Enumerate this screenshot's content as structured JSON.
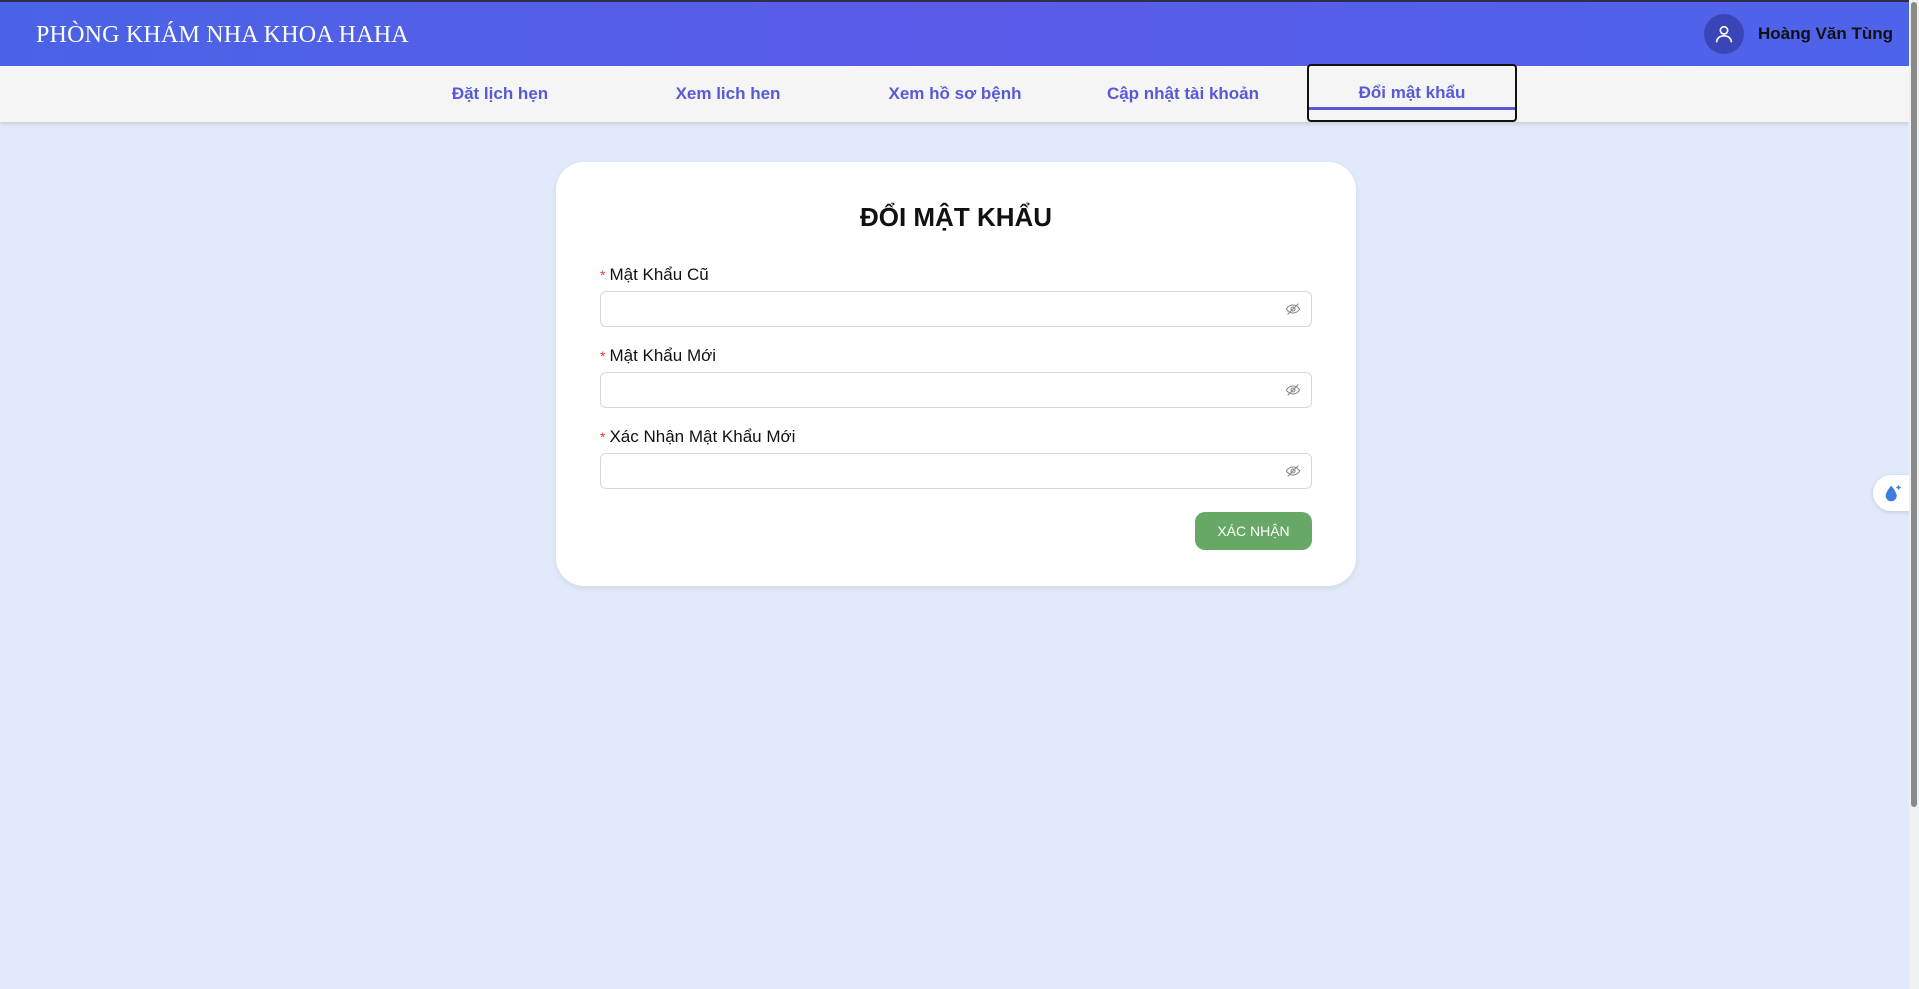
{
  "header": {
    "brand": "PHÒNG KHÁM NHA KHOA HAHA",
    "user_name": "Hoàng Văn Tùng"
  },
  "nav": {
    "items": [
      {
        "label": "Đặt lịch hẹn"
      },
      {
        "label": "Xem lich hen"
      },
      {
        "label": "Xem hồ sơ bệnh"
      },
      {
        "label": "Cập nhật tài khoản"
      },
      {
        "label": "Đổi mật khẩu",
        "active": true
      }
    ]
  },
  "form": {
    "title": "ĐỔI MẬT KHẨU",
    "fields": [
      {
        "label": "Mật Khẩu Cũ",
        "required": true,
        "value": ""
      },
      {
        "label": "Mật Khẩu Mới",
        "required": true,
        "value": ""
      },
      {
        "label": "Xác Nhận Mật Khẩu Mới",
        "required": true,
        "value": ""
      }
    ],
    "required_mark": "*",
    "submit_label": "XÁC NHẬN"
  },
  "colors": {
    "accent": "#5759d6",
    "submit": "#67a867",
    "background": "#e1eafa"
  },
  "icons": {
    "avatar": "user-icon",
    "password_toggle": "eye-off-icon",
    "widget": "droplet-sparkle-icon"
  }
}
